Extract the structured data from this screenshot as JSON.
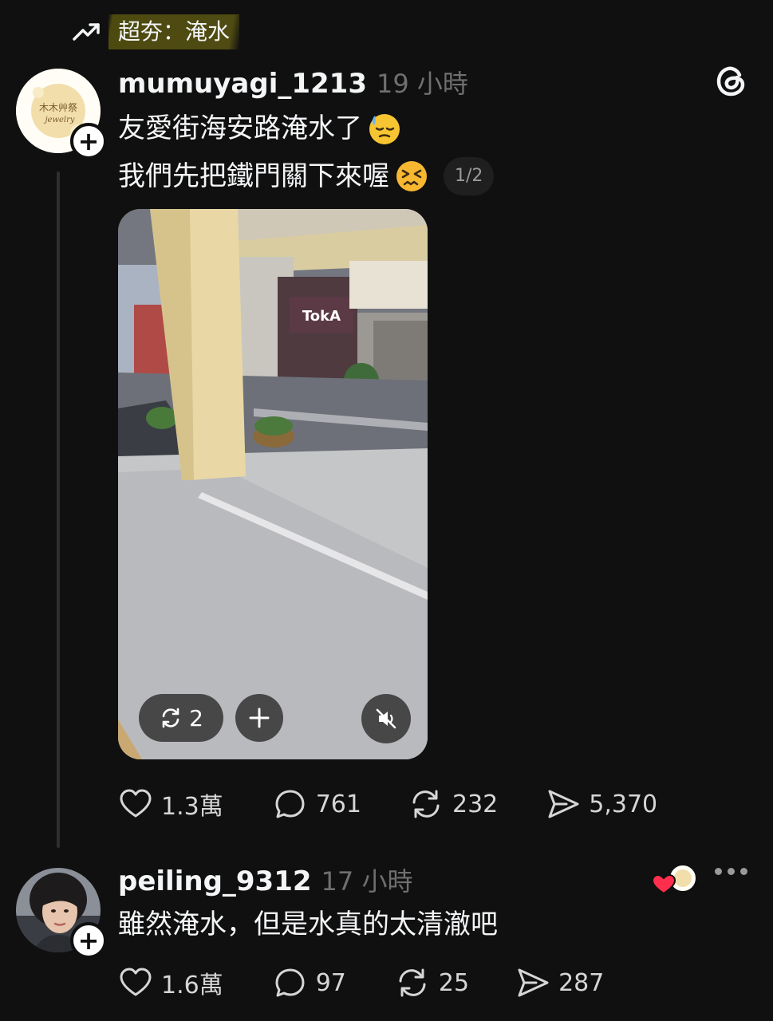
{
  "trending": {
    "icon": "trending-up-icon",
    "label": "超夯：淹水"
  },
  "post": {
    "username": "mumuyagi_1213",
    "time": "19 小時",
    "avatar_text": "木木艸祭",
    "avatar_subtext": "jewelry",
    "lines": [
      "友愛街海安路淹水了",
      "我們先把鐵門關下來喔"
    ],
    "page_indicator": "1/2",
    "video": {
      "store_sign": "TokA",
      "repost_count": "2"
    },
    "actions": {
      "likes": "1.3萬",
      "comments": "761",
      "reposts": "232",
      "shares": "5,370"
    }
  },
  "reply": {
    "username": "peiling_9312",
    "time": "17 小時",
    "text": "雖然淹水，但是水真的太清澈吧",
    "actions": {
      "likes": "1.6萬",
      "comments": "97",
      "reposts": "25",
      "shares": "287"
    }
  },
  "colors": {
    "background": "#101010",
    "text": "#f3f5f7",
    "muted": "#6f6f6f",
    "trend_highlight": "#4f4b12",
    "liked_heart": "#ff2e4d"
  }
}
